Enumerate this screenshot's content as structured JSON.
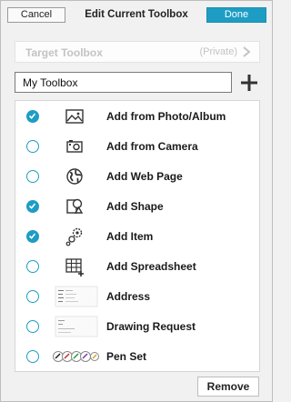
{
  "header": {
    "cancel_label": "Cancel",
    "title": "Edit Current Toolbox",
    "done_label": "Done"
  },
  "target_toolbox": {
    "label": "Target Toolbox",
    "status": "(Private)"
  },
  "name_field": {
    "value": "My Toolbox"
  },
  "items": [
    {
      "label": "Add from Photo/Album",
      "checked": true,
      "icon": "photo-icon"
    },
    {
      "label": "Add from Camera",
      "checked": false,
      "icon": "camera-icon"
    },
    {
      "label": "Add Web Page",
      "checked": false,
      "icon": "globe-icon"
    },
    {
      "label": "Add Shape",
      "checked": true,
      "icon": "shape-icon"
    },
    {
      "label": "Add Item",
      "checked": true,
      "icon": "item-icon"
    },
    {
      "label": "Add Spreadsheet",
      "checked": false,
      "icon": "spreadsheet-icon"
    },
    {
      "label": "Address",
      "checked": false,
      "icon": "address-thumbnail-icon"
    },
    {
      "label": "Drawing Request",
      "checked": false,
      "icon": "drawing-request-thumbnail-icon"
    },
    {
      "label": "Pen Set",
      "checked": false,
      "icon": "pen-set-icon"
    }
  ],
  "footer": {
    "remove_label": "Remove"
  },
  "colors": {
    "accent": "#1e9dc4"
  }
}
